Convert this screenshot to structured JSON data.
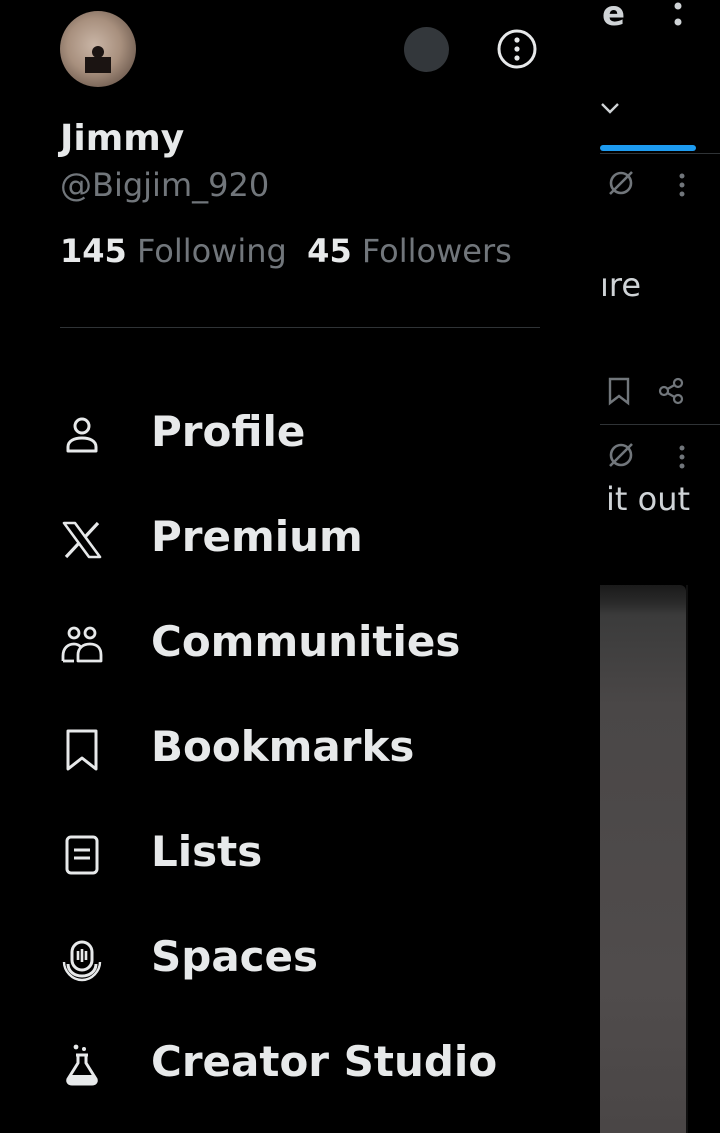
{
  "user": {
    "display_name": "Jimmy",
    "handle": "@Bigjim_920",
    "following_count": "145",
    "following_label": "Following",
    "followers_count": "45",
    "followers_label": "Followers"
  },
  "menu": [
    {
      "label": "Profile",
      "icon": "person-icon"
    },
    {
      "label": "Premium",
      "icon": "x-logo-icon"
    },
    {
      "label": "Communities",
      "icon": "communities-icon"
    },
    {
      "label": "Bookmarks",
      "icon": "bookmark-icon"
    },
    {
      "label": "Lists",
      "icon": "list-icon"
    },
    {
      "label": "Spaces",
      "icon": "spaces-icon"
    },
    {
      "label": "Creator Studio",
      "icon": "flask-icon"
    }
  ],
  "background_timeline": {
    "header_fragment": "e",
    "post_text_1": "ıre",
    "post_text_2": "it out"
  },
  "colors": {
    "background": "#000000",
    "primary_text": "#e7e9ea",
    "secondary_text": "#71767b",
    "accent": "#1d9bf0",
    "divider": "#2f3336"
  }
}
